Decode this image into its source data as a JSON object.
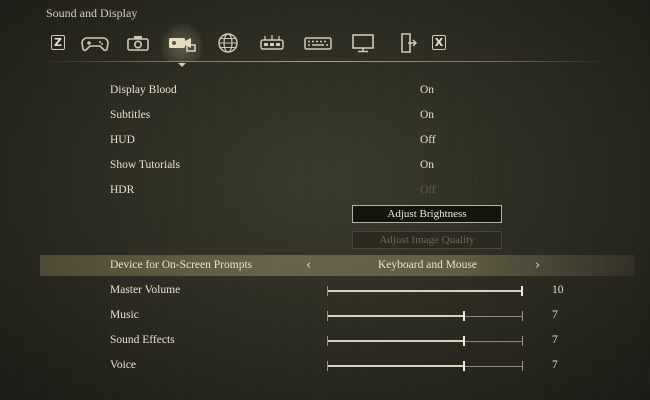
{
  "window": {
    "title": "Sound and Display"
  },
  "tabs": {
    "left_key": "Z",
    "right_key": "X",
    "icons": [
      {
        "name": "gamepad-icon"
      },
      {
        "name": "camera-icon"
      },
      {
        "name": "display-camera-icon",
        "selected": true
      },
      {
        "name": "globe-icon"
      },
      {
        "name": "controller-buttons-icon"
      },
      {
        "name": "keyboard-icon"
      },
      {
        "name": "monitor-icon"
      },
      {
        "name": "exit-door-icon"
      }
    ]
  },
  "settings": {
    "display_blood": {
      "label": "Display Blood",
      "value": "On"
    },
    "subtitles": {
      "label": "Subtitles",
      "value": "On"
    },
    "hud": {
      "label": "HUD",
      "value": "Off"
    },
    "show_tutorials": {
      "label": "Show Tutorials",
      "value": "On"
    },
    "hdr": {
      "label": "HDR",
      "value": "Off",
      "disabled": true
    }
  },
  "buttons": {
    "adjust_brightness": "Adjust Brightness",
    "adjust_image_quality": "Adjust Image Quality"
  },
  "device_prompts": {
    "label": "Device for On-Screen Prompts",
    "value": "Keyboard and Mouse",
    "left_arrow": "‹",
    "right_arrow": "›"
  },
  "volume": {
    "master": {
      "label": "Master Volume",
      "value": "10",
      "level": 10,
      "max": 10
    },
    "music": {
      "label": "Music",
      "value": "7",
      "level": 7,
      "max": 10
    },
    "sound_effects": {
      "label": "Sound Effects",
      "value": "7",
      "level": 7,
      "max": 10
    },
    "voice": {
      "label": "Voice",
      "value": "7",
      "level": 7,
      "max": 10
    }
  },
  "colors": {
    "text": "#e8e2cf",
    "disabled_text": "#5e5a4c",
    "highlight": "#a09670"
  }
}
